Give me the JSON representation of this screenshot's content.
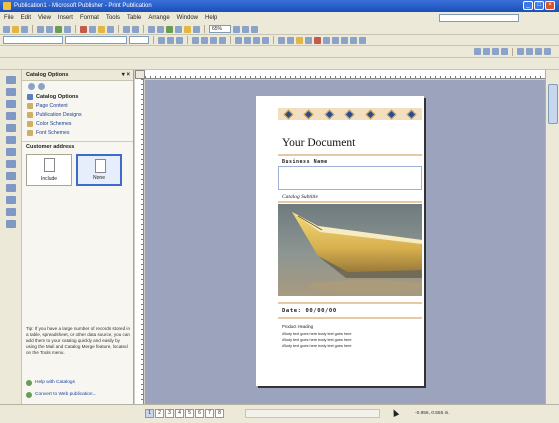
{
  "window": {
    "title": "Publication1 - Microsoft Publisher - Print Publication"
  },
  "menu": [
    "File",
    "Edit",
    "View",
    "Insert",
    "Format",
    "Tools",
    "Table",
    "Arrange",
    "Window",
    "Help"
  ],
  "toolbar": {
    "zoom": "65%"
  },
  "taskpane": {
    "title": "Catalog Options",
    "section_title": "Catalog Options",
    "links": [
      "Page Content",
      "Publication Designs",
      "Color Schemes",
      "Font Schemes"
    ],
    "customer_address_label": "Customer address",
    "options": [
      {
        "label": "Include",
        "selected": false
      },
      {
        "label": "None",
        "selected": true
      }
    ],
    "tip": "Tip: If you have a large number of records stored in a table, spreadsheet, or other data source, you can add them to your catalog quickly and easily by using the Mail and Catalog Merge feature, located on the Tools menu.",
    "help_link": "Help with Catalogs",
    "convert_link": "Convert to Web publication..."
  },
  "document": {
    "title": "Your Document",
    "business_name": "Business Name",
    "catalog_title": "Catalog Subtitle",
    "date": "Date: 00/00/00",
    "product_heading": "Product Heading",
    "bullets": [
      "Body text goes here body text goes here",
      "Body text goes here body text goes here",
      "Body text goes here body text goes here"
    ]
  },
  "status": {
    "pages": [
      "1",
      "2",
      "3",
      "4",
      "5",
      "6",
      "7",
      "8"
    ],
    "active_page": "1",
    "position": "-0.956, 0.555 in."
  },
  "colors": {
    "accent": "#3c6bc9",
    "workspace": "#9ca3bc",
    "pattern_bg": "#f1dfc0"
  }
}
